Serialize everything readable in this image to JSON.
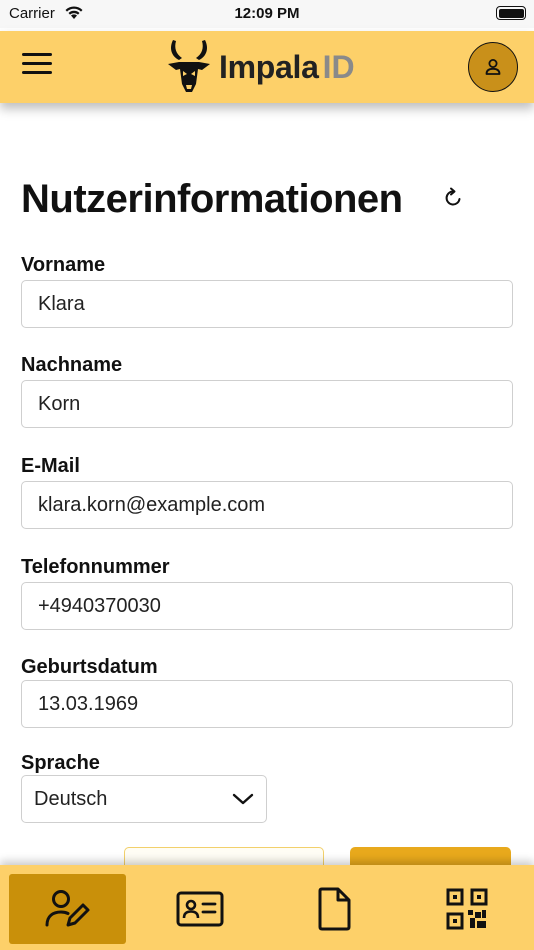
{
  "status_bar": {
    "carrier": "Carrier",
    "time": "12:09 PM"
  },
  "header": {
    "logo_text": "Impala",
    "logo_suffix": "ID",
    "background_color": "#fdd069",
    "icons": [
      "menu-icon",
      "impala-logo-icon",
      "user-icon"
    ]
  },
  "page": {
    "title": "Nutzerinformationen",
    "refresh_icon": "refresh-icon"
  },
  "form": {
    "first_name": {
      "label": "Vorname",
      "value": "Klara"
    },
    "last_name": {
      "label": "Nachname",
      "value": "Korn"
    },
    "email": {
      "label": "E-Mail",
      "value": "klara.korn@example.com"
    },
    "phone": {
      "label": "Telefonnummer",
      "value": "+4940370030"
    },
    "birthdate": {
      "label": "Geburtsdatum",
      "value": "13.03.1969"
    },
    "language": {
      "label": "Sprache",
      "value": "Deutsch"
    }
  },
  "tab_bar": {
    "tabs": [
      {
        "icon": "user-edit-icon",
        "active": true
      },
      {
        "icon": "id-card-icon",
        "active": false
      },
      {
        "icon": "document-icon",
        "active": false
      },
      {
        "icon": "qr-code-icon",
        "active": false
      }
    ],
    "active_color": "#c9900a"
  }
}
